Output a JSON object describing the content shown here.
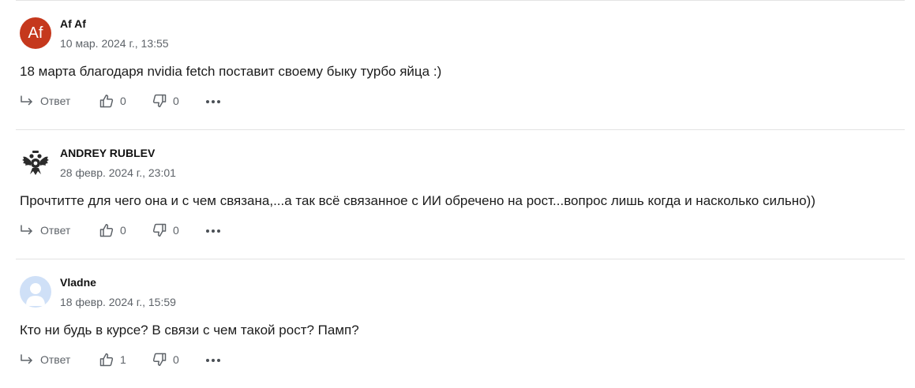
{
  "comments": [
    {
      "author": "Af Af",
      "avatar": {
        "type": "initials",
        "initials": "Af",
        "color": "#c5381d"
      },
      "date": "10 мар. 2024 г., 13:55",
      "text": "18 марта благодаря nvidia fetch поставит своему быку турбо яйца :)",
      "reply_label": "Ответ",
      "likes": "0",
      "dislikes": "0"
    },
    {
      "author": "ANDREY RUBLEV",
      "avatar": {
        "type": "image",
        "icon": "double-headed-eagle-emblem"
      },
      "date": "28 февр. 2024 г., 23:01",
      "text": "Прочтитте для чего она и с чем связана,...а так всё связанное с ИИ обречено на рост...вопрос лишь когда и насколько сильно))",
      "reply_label": "Ответ",
      "likes": "0",
      "dislikes": "0"
    },
    {
      "author": "Vladne",
      "avatar": {
        "type": "placeholder",
        "icon": "default-user-icon",
        "color": "#cfe0f7"
      },
      "date": "18 февр. 2024 г., 15:59",
      "text": "Кто ни будь в курсе? В связи с чем такой рост? Памп?",
      "reply_label": "Ответ",
      "likes": "1",
      "dislikes": "0"
    }
  ],
  "icons": {
    "reply": "reply-arrow-icon",
    "like": "thumbs-up-icon",
    "dislike": "thumbs-down-icon",
    "more": "more-dots-icon"
  },
  "colors": {
    "text": "#1c1c1c",
    "muted": "#5e6369",
    "divider": "#e3e3e3"
  }
}
